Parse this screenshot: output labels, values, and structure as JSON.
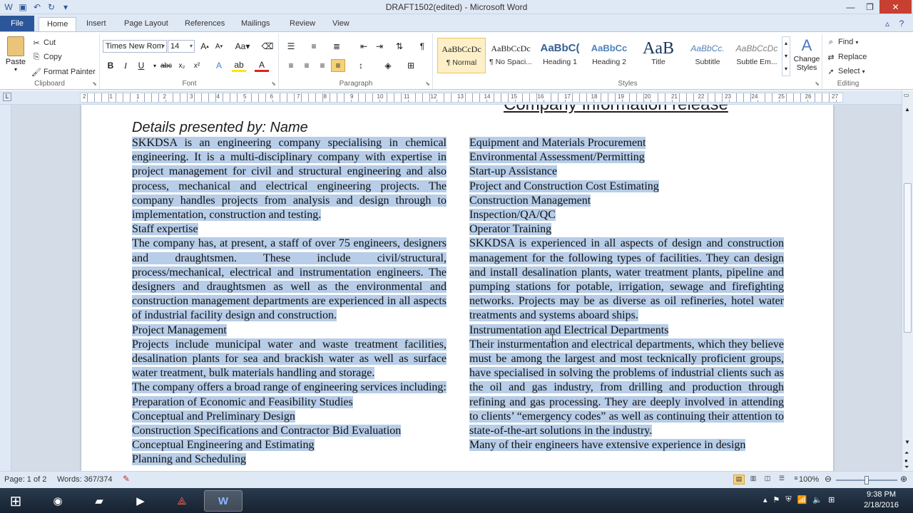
{
  "window": {
    "title": "DRAFT1502(edited) - Microsoft Word"
  },
  "tabs": [
    "File",
    "Home",
    "Insert",
    "Page Layout",
    "References",
    "Mailings",
    "Review",
    "View"
  ],
  "clipboard": {
    "paste": "Paste",
    "cut": "Cut",
    "copy": "Copy",
    "format_painter": "Format Painter",
    "label": "Clipboard"
  },
  "font": {
    "family": "Times New Rom",
    "size": "14",
    "label": "Font"
  },
  "paragraph": {
    "label": "Paragraph"
  },
  "styles": {
    "items": [
      {
        "preview": "AaBbCcDc",
        "name": "¶ Normal"
      },
      {
        "preview": "AaBbCcDc",
        "name": "¶ No Spaci..."
      },
      {
        "preview": "AaBbC(",
        "name": "Heading 1"
      },
      {
        "preview": "AaBbCc",
        "name": "Heading 2"
      },
      {
        "preview": "AaB",
        "name": "Title"
      },
      {
        "preview": "AaBbCc.",
        "name": "Subtitle"
      },
      {
        "preview": "AaBbCcDc",
        "name": "Subtle Em..."
      }
    ],
    "change": "Change Styles",
    "label": "Styles"
  },
  "editing": {
    "find": "Find",
    "replace": "Replace",
    "select": "Select",
    "label": "Editing"
  },
  "ruler": {
    "numbers": [
      "2",
      "1",
      "1",
      "2",
      "3",
      "4",
      "5",
      "6",
      "7",
      "8",
      "9",
      "10",
      "11",
      "12",
      "13",
      "14",
      "15",
      "16",
      "17",
      "18",
      "19",
      "20",
      "21",
      "22",
      "23",
      "24",
      "25",
      "26",
      "27"
    ]
  },
  "document": {
    "heading": "Company Information release",
    "byline": "Details presented by: Name",
    "col1": [
      "SKKDSA is an engineering company specialising in chemical engineering. It is a multi-disciplinary company with expertise in project management for civil and structural engineering and also process, mechanical and electrical engineering projects. The company handles projects from analysis and design through to implementation, construction and testing.",
      "Staff expertise",
      "The company has, at present, a staff of over 75 engineers, designers and draughtsmen. These include civil/structural, process/mechanical, electrical and instrumentation engineers. The designers and draughtsmen as well as the environmental and construction management departments are experienced in all aspects of industrial facility design and construction.",
      "Project Management",
      "Projects include municipal water and waste treatment facilities, desalination plants for sea and brackish water as well as surface water treatment, bulk materials handling and storage.",
      "The company offers a broad range of engineering services including:",
      "Preparation of Economic and Feasibility Studies",
      "Conceptual and Preliminary Design",
      "Construction Specifications and Contractor Bid Evaluation",
      "Conceptual Engineering and Estimating",
      "Planning and Scheduling"
    ],
    "col2": [
      "Equipment and Materials Procurement",
      "Environmental Assessment/Permitting",
      "Start-up Assistance",
      "Project and Construction Cost Estimating",
      "Construction Management",
      "Inspection/QA/QC",
      "Operator Training",
      "SKKDSA is experienced in all aspects of design and construction management for the following types of facilities. They can design and install desalination plants, water treatment plants, pipeline and pumping stations for potable, irrigation, sewage and firefighting networks. Projects may be as diverse as oil refineries, hotel water treatments and systems aboard ships.",
      "Instrumentation and Electrical Departments",
      "Their insturmentation and electrical departments, which they believe must be among the largest and most tecknically proficient groups, have specialised in solving the problems of industrial clients such as the oil and gas industry, from drilling and production through refining and gas processing. They are deeply involved in attending to clients’ “emergency codes” as well as continuing their attention to state-of-the-art solutions in the industry.",
      "Many of their engineers have extensive experience in design"
    ]
  },
  "status": {
    "page": "Page: 1 of 2",
    "words": "Words: 367/374",
    "zoom": "100%"
  },
  "clock": {
    "time": "9:38 PM",
    "date": "2/18/2016"
  },
  "colors": {
    "accent": "#2b579a",
    "selection": "#b7cde8"
  }
}
